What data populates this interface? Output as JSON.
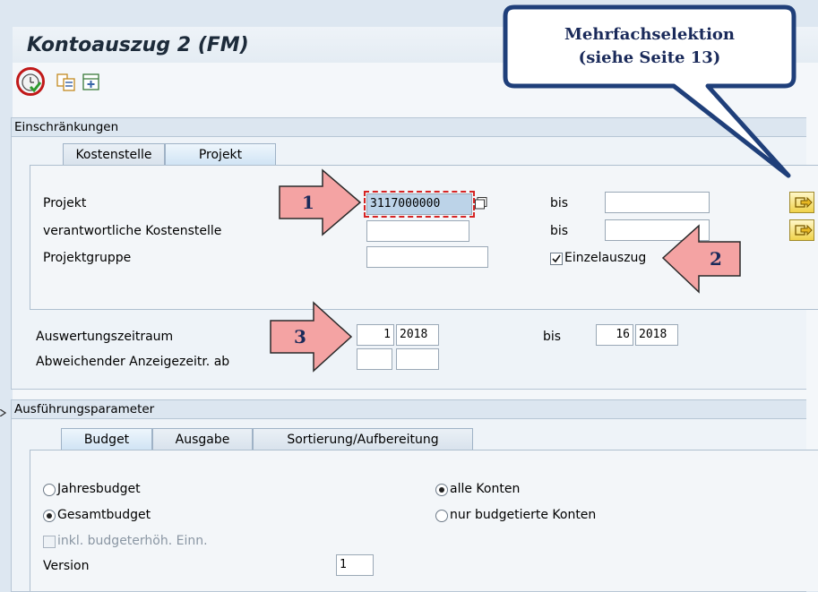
{
  "window": {
    "title": "Kontoauszug 2 (FM)"
  },
  "toolbar": {
    "icons": [
      "execute-icon",
      "copy-variant-icon",
      "add-variant-icon"
    ]
  },
  "callout": {
    "line1": "Mehrfachselektion",
    "line2": "(siehe Seite 13)"
  },
  "einschraenkungen": {
    "header": "Einschränkungen",
    "tabs": [
      "Kostenstelle",
      "Projekt"
    ],
    "active_tab": "Projekt",
    "fields": {
      "projekt_label": "Projekt",
      "projekt_value": "3117000000",
      "kostenstelle_label": "verantwortliche Kostenstelle",
      "kostenstelle_value": "",
      "projektgruppe_label": "Projektgruppe",
      "projektgruppe_value": "",
      "bis1_label": "bis",
      "bis1_value": "",
      "bis2_label": "bis",
      "bis2_value": "",
      "einzelauszug_label": "Einzelauszug",
      "einzelauszug_checked": true
    },
    "zeitraum": {
      "label": "Auswertungszeitraum",
      "from_period": "1",
      "from_year": "2018",
      "bis_label": "bis",
      "to_period": "16",
      "to_year": "2018",
      "abw_label": "Abweichender Anzeigezeitr. ab",
      "abw_period": "",
      "abw_year": ""
    }
  },
  "arrows": {
    "one": "1",
    "two": "2",
    "three": "3"
  },
  "ausfuehrung": {
    "header": "Ausführungsparameter",
    "tabs": [
      "Budget",
      "Ausgabe",
      "Sortierung/Aufbereitung"
    ],
    "active_tab": "Budget",
    "jahresbudget_label": "Jahresbudget",
    "gesamtbudget_label": "Gesamtbudget",
    "gesamtbudget_selected": true,
    "inkl_label": "inkl. budgeterhöh. Einn.",
    "alle_konten_label": "alle Konten",
    "alle_konten_selected": true,
    "nur_budgetiert_label": "nur budgetierte Konten",
    "version_label": "Version",
    "version_value": "1"
  },
  "colors": {
    "callout_fill": "#ffffff",
    "callout_border": "#1f3f7a",
    "callout_text": "#1f3f7a",
    "arrow_fill": "#f4a3a3",
    "arrow_stroke": "#2a2a2a",
    "highlight_ring": "#c01818"
  }
}
